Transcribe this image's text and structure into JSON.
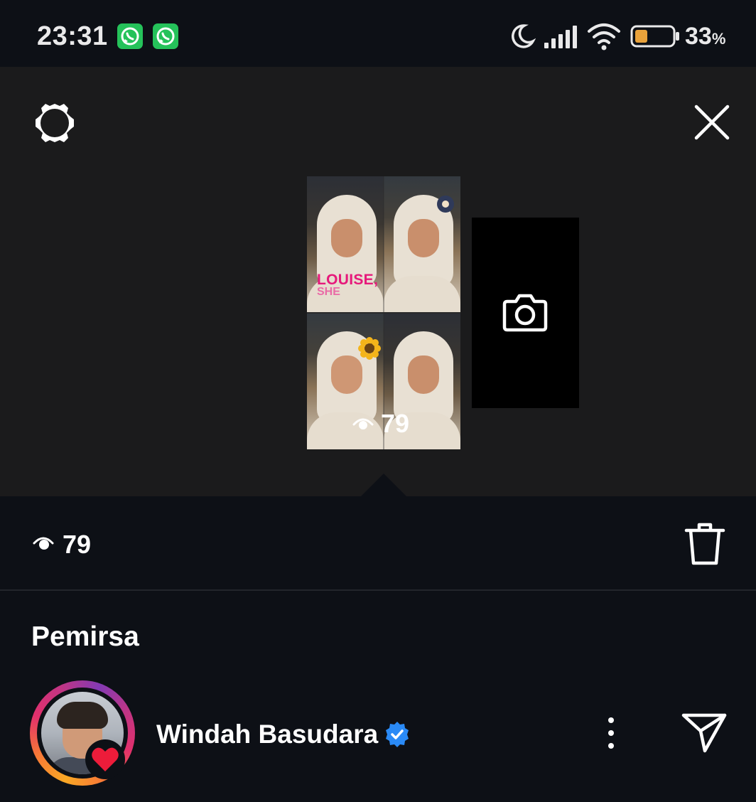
{
  "status_bar": {
    "time": "23:31",
    "notifications": [
      "whatsapp-icon",
      "whatsapp-icon"
    ],
    "icons": [
      "moon-icon",
      "signal-icon",
      "wifi-icon",
      "battery-icon"
    ],
    "battery_percent": "33",
    "battery_unit": "%",
    "battery_level": 0.33,
    "battery_color": "#e9a23b"
  },
  "top_panel": {
    "settings_icon": "gear-icon",
    "close_icon": "close-icon",
    "story_thumbnail": {
      "overlay_text": "LOUISE,",
      "overlay_subtext": "SHE",
      "view_count": "79"
    },
    "add_story_icon": "camera-icon"
  },
  "stats": {
    "views_icon": "eye-icon",
    "views": "79",
    "delete_icon": "trash-icon"
  },
  "viewers": {
    "title": "Pemirsa",
    "items": [
      {
        "name": "Windah Basudara",
        "verified": true,
        "reaction": "heart",
        "reaction_color": "#ed1c3a",
        "verified_color": "#2a8af6"
      }
    ]
  },
  "colors": {
    "background": "#0d1016",
    "panel": "#1b1b1c",
    "text": "#ffffff",
    "accent_pink": "#e6197b"
  }
}
